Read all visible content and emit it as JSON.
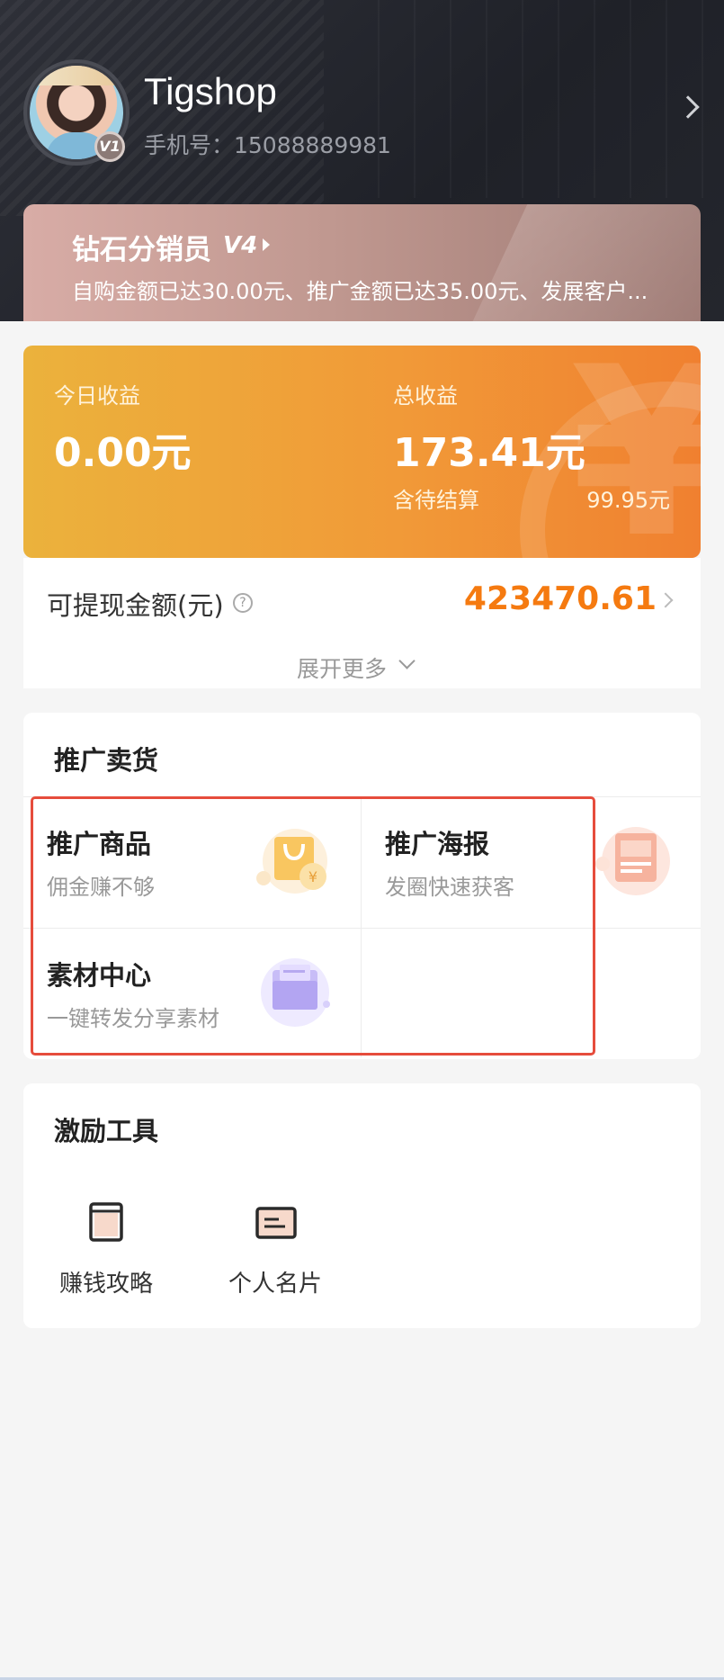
{
  "profile": {
    "username": "Tigshop",
    "phone": "手机号：15088889981",
    "level_badge": "V1"
  },
  "vip": {
    "title": "钻石分销员",
    "level": "V4",
    "description": "自购金额已达30.00元、推广金额已达35.00元、发展客户..."
  },
  "earnings": {
    "today_label": "今日收益",
    "today_value": "0.00元",
    "total_label": "总收益",
    "total_value": "173.41元",
    "pending_label": "含待结算",
    "pending_value": "99.95元"
  },
  "withdraw": {
    "label": "可提现金额(元)",
    "help": "?",
    "value": "423470.61",
    "expand": "展开更多"
  },
  "promotion": {
    "title": "推广卖货",
    "tiles": [
      {
        "title": "推广商品",
        "subtitle": "佣金赚不够",
        "icon": "shopping-bag-icon"
      },
      {
        "title": "推广海报",
        "subtitle": "发圈快速获客",
        "icon": "poster-icon"
      },
      {
        "title": "素材中心",
        "subtitle": "一键转发分享素材",
        "icon": "folder-icon"
      }
    ]
  },
  "tools": {
    "title": "激励工具",
    "items": [
      {
        "label": "赚钱攻略",
        "icon": "book-icon"
      },
      {
        "label": "个人名片",
        "icon": "card-icon"
      }
    ]
  },
  "colors": {
    "accent_orange": "#f57a10",
    "header_bg": "#23252c",
    "highlight_border": "#e64c3c"
  }
}
